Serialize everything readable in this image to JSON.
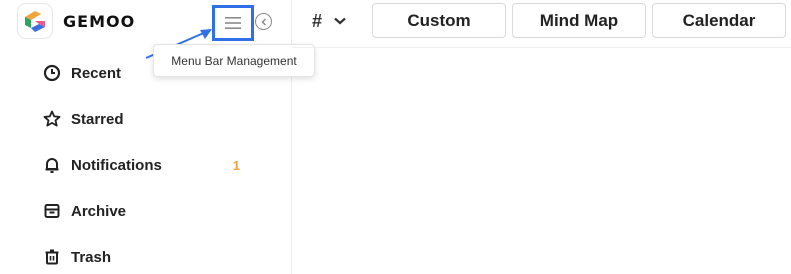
{
  "brand": {
    "name": "GEMOO"
  },
  "menu_button": {
    "icon": "hamburger-menu-icon"
  },
  "collapse_button": {
    "icon": "chevron-left-circle-icon"
  },
  "tooltip": {
    "text": "Menu Bar Management"
  },
  "sidebar": {
    "items": [
      {
        "label": "Recent",
        "icon": "clock-icon"
      },
      {
        "label": "Starred",
        "icon": "star-icon"
      },
      {
        "label": "Notifications",
        "icon": "bell-icon",
        "count": "1"
      },
      {
        "label": "Archive",
        "icon": "archive-box-icon"
      },
      {
        "label": "Trash",
        "icon": "trash-icon"
      }
    ]
  },
  "toolbar": {
    "hash_label": "#",
    "tabs": [
      {
        "label": "Custom"
      },
      {
        "label": "Mind Map"
      },
      {
        "label": "Calendar"
      }
    ]
  },
  "colors": {
    "highlight": "#2f6fe8",
    "count": "#f0a040"
  }
}
